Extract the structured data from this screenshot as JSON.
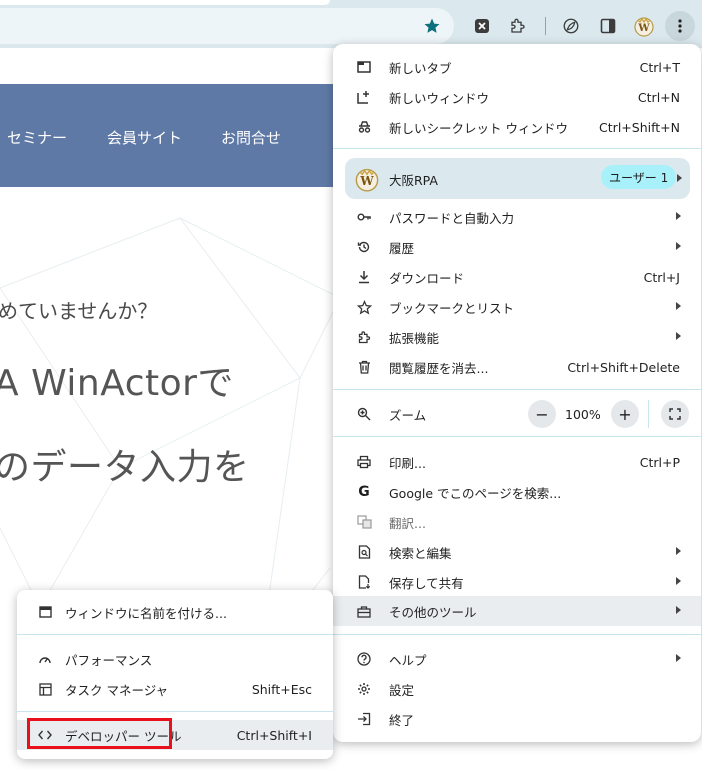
{
  "chrome": {
    "icons": [
      "star-icon",
      "extension-x-icon",
      "puzzle-icon",
      "leaf-icon",
      "side-panel-icon",
      "profile-w-icon",
      "kebab-icon"
    ],
    "accent": "#1a7f8e"
  },
  "page": {
    "nav": [
      "セミナー",
      "会員サイト",
      "お問合せ"
    ],
    "hero_sub": "めていませんか？",
    "hero_line1": "A WinActorで",
    "hero_line2": "のデータ入力を",
    "nav_color": "#5f79a6"
  },
  "menu": {
    "new_tab": {
      "label": "新しいタブ",
      "shortcut": "Ctrl+T"
    },
    "new_window": {
      "label": "新しいウィンドウ",
      "shortcut": "Ctrl+N"
    },
    "incognito": {
      "label": "新しいシークレット ウィンドウ",
      "shortcut": "Ctrl+Shift+N"
    },
    "profile": {
      "name": "大阪RPA",
      "badge": "ユーザー 1"
    },
    "passwords": {
      "label": "パスワードと自動入力"
    },
    "history": {
      "label": "履歴"
    },
    "downloads": {
      "label": "ダウンロード",
      "shortcut": "Ctrl+J"
    },
    "bookmarks": {
      "label": "ブックマークとリスト"
    },
    "extensions": {
      "label": "拡張機能"
    },
    "clear_data": {
      "label": "閲覧履歴を消去...",
      "shortcut": "Ctrl+Shift+Delete"
    },
    "zoom": {
      "label": "ズーム",
      "minus": "−",
      "value": "100%",
      "plus": "+"
    },
    "print": {
      "label": "印刷...",
      "shortcut": "Ctrl+P"
    },
    "google_search": {
      "label": "Google でこのページを検索..."
    },
    "translate": {
      "label": "翻訳..."
    },
    "find_edit": {
      "label": "検索と編集"
    },
    "save_share": {
      "label": "保存して共有"
    },
    "more_tools": {
      "label": "その他のツール"
    },
    "help": {
      "label": "ヘルプ"
    },
    "settings": {
      "label": "設定"
    },
    "exit": {
      "label": "終了"
    }
  },
  "submenu": {
    "name_window": {
      "label": "ウィンドウに名前を付ける..."
    },
    "performance": {
      "label": "パフォーマンス"
    },
    "task_manager": {
      "label": "タスク マネージャ",
      "shortcut": "Shift+Esc"
    },
    "dev_tools": {
      "label": "デベロッパー ツール",
      "shortcut": "Ctrl+Shift+I"
    },
    "highlight_color": "#e8101a"
  }
}
